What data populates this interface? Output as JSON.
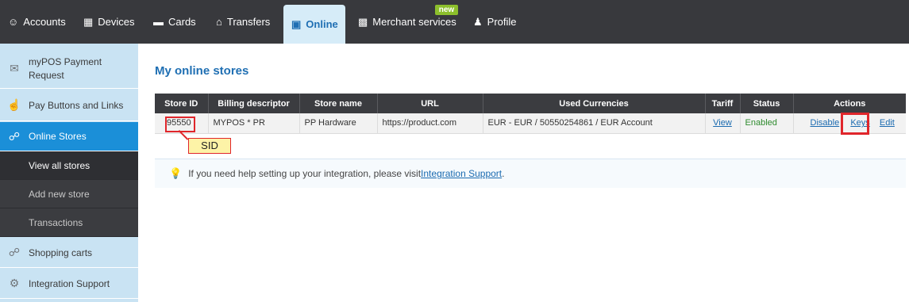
{
  "nav": {
    "items": [
      {
        "label": "Accounts",
        "icon": "users-icon"
      },
      {
        "label": "Devices",
        "icon": "pos-terminal-icon"
      },
      {
        "label": "Cards",
        "icon": "card-icon"
      },
      {
        "label": "Transfers",
        "icon": "bank-icon"
      },
      {
        "label": "Online",
        "icon": "monitor-icon",
        "active": true
      },
      {
        "label": "Merchant services",
        "icon": "store-icon",
        "badge": "new"
      },
      {
        "label": "Profile",
        "icon": "person-icon"
      }
    ]
  },
  "sidebar": {
    "items": [
      {
        "label": "myPOS Payment Request",
        "icon": "envelope-icon"
      },
      {
        "label": "Pay Buttons and Links",
        "icon": "hand-pointer-icon"
      },
      {
        "label": "Online Stores",
        "icon": "cart-icon",
        "active": true
      },
      {
        "label": "Shopping carts",
        "icon": "cart-icon"
      },
      {
        "label": "Integration Support",
        "icon": "gear-search-icon"
      }
    ],
    "subitems": [
      {
        "label": "View all stores",
        "current": true
      },
      {
        "label": "Add new store"
      },
      {
        "label": "Transactions"
      }
    ]
  },
  "main": {
    "title": "My online stores",
    "table": {
      "headers": [
        "Store ID",
        "Billing descriptor",
        "Store name",
        "URL",
        "Used Currencies",
        "Tariff",
        "Status",
        "Actions"
      ],
      "rows": [
        {
          "store_id": "95550",
          "billing_descriptor": "MYPOS * PR",
          "store_name": "PP Hardware",
          "url": "https://product.com",
          "currencies": "EUR - EUR / 50550254861 / EUR Account",
          "tariff": "View",
          "status": "Enabled",
          "actions": [
            "Disable",
            "Keys",
            "Edit"
          ]
        }
      ]
    },
    "annotation": "SID",
    "help": {
      "text": "If you need help setting up your integration, please visit ",
      "link": "Integration Support",
      "suffix": "."
    }
  },
  "colors": {
    "nav_bg": "#38393d",
    "accent_blue": "#1f6fb3",
    "sidebar_bg": "#c9e3f3",
    "sidebar_active": "#1b8fd8",
    "highlight_red": "#e0262b",
    "new_badge": "#8cbf2c"
  }
}
